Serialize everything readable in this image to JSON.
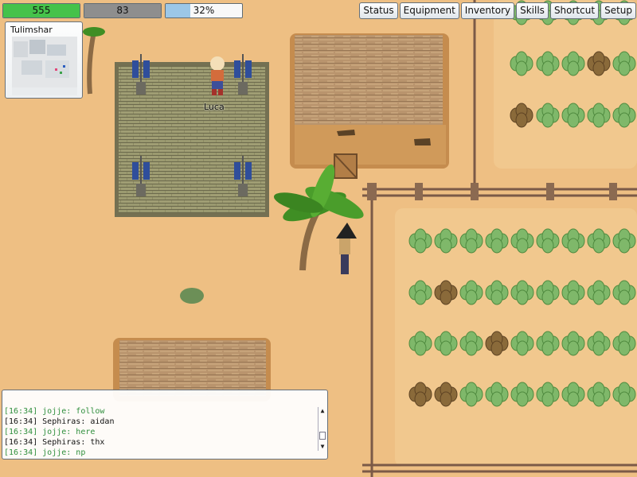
{
  "hud": {
    "hp": {
      "text": "555",
      "fraction": 1.0,
      "color": "#45c24a"
    },
    "mp": {
      "text": "83",
      "fraction": 1.0,
      "color": "#8e8e8e"
    },
    "xp": {
      "text": "32%",
      "fraction": 0.32,
      "color": "#9cc7e7"
    }
  },
  "menu": [
    {
      "label": "Status",
      "name": "status-button"
    },
    {
      "label": "Equipment",
      "name": "equipment-button"
    },
    {
      "label": "Inventory",
      "name": "inventory-button"
    },
    {
      "label": "Skills",
      "name": "skills-button"
    },
    {
      "label": "Shortcut",
      "name": "shortcut-button"
    },
    {
      "label": "Setup",
      "name": "setup-button"
    }
  ],
  "minimap": {
    "title": "Tulimshar"
  },
  "characters": {
    "luca_name": "Luca"
  },
  "chat": {
    "lines": [
      {
        "text": "[16:34] jojje: follow",
        "color": "#2f8f3d"
      },
      {
        "text": "[16:34] Sephiras: aidan",
        "color": "#111111"
      },
      {
        "text": "[16:34] jojje: here",
        "color": "#2f8f3d"
      },
      {
        "text": "[16:34] Sephiras: thx",
        "color": "#111111"
      },
      {
        "text": "[16:34] jojje: np",
        "color": "#2f8f3d"
      }
    ],
    "scroll_up": "▲",
    "scroll_down": "▼"
  }
}
